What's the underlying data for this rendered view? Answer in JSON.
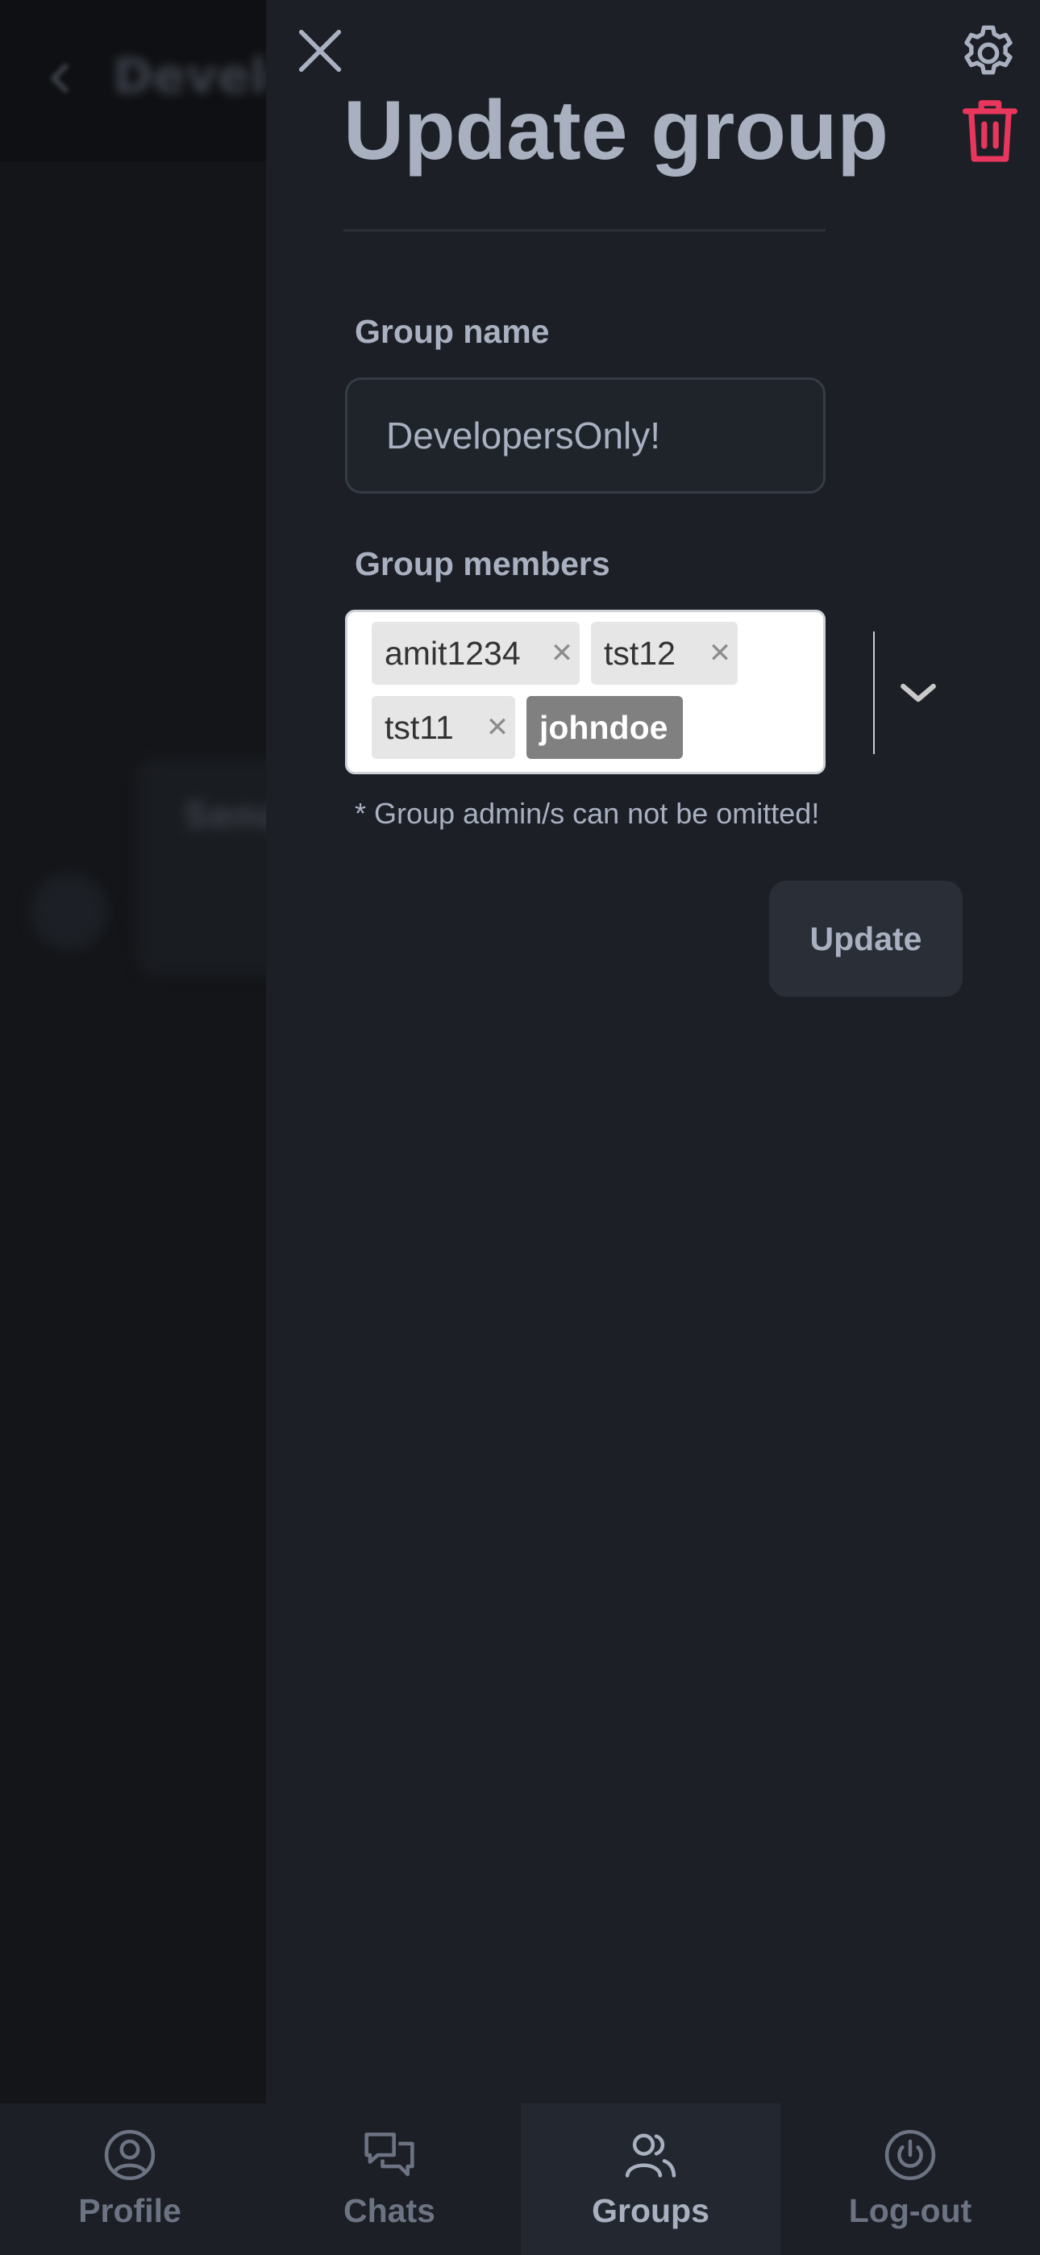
{
  "background_page": {
    "header_title": "Develo",
    "bubble_text": "Send"
  },
  "drawer": {
    "title": "Update group",
    "group_name": {
      "label": "Group name",
      "value": "DevelopersOnly!"
    },
    "group_members": {
      "label": "Group members",
      "selected": [
        {
          "name": "amit1234",
          "removable": true
        },
        {
          "name": "tst12",
          "removable": true
        },
        {
          "name": "tst11",
          "removable": true
        },
        {
          "name": "johndoe",
          "removable": false,
          "admin": true
        }
      ]
    },
    "hint": "* Group admin/s can not be omitted!",
    "update_label": "Update"
  },
  "bottom_nav": {
    "items": [
      {
        "label": "Profile",
        "icon": "user-circle-icon",
        "active": false
      },
      {
        "label": "Chats",
        "icon": "chat-bubbles-icon",
        "active": false
      },
      {
        "label": "Groups",
        "icon": "users-icon",
        "active": true
      },
      {
        "label": "Log-out",
        "icon": "power-icon",
        "active": false
      }
    ]
  },
  "colors": {
    "background": "#1a1d23",
    "drawer_background": "#1c1f26",
    "text": "#a9b1c1",
    "muted_text": "#6c7483",
    "delete_accent": "#e8365d",
    "admin_tag": "#808080"
  }
}
